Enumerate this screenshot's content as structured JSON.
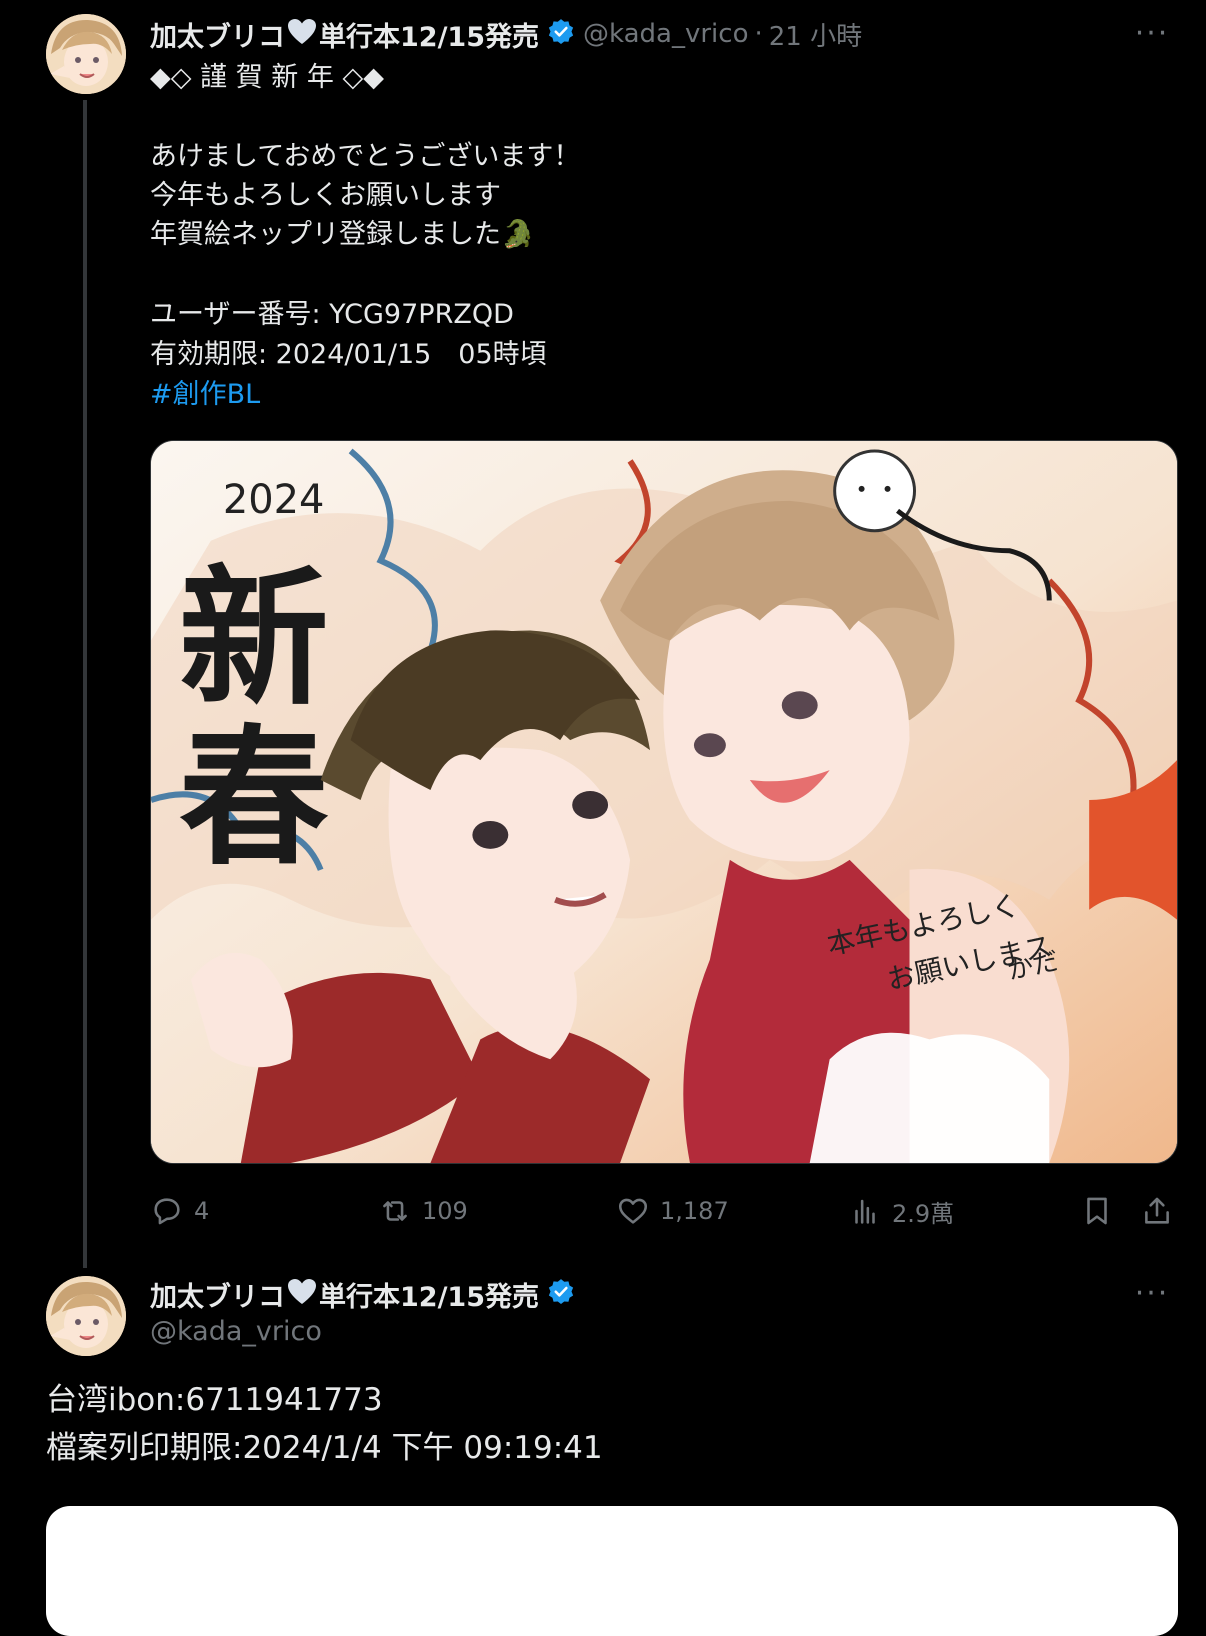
{
  "tweet1": {
    "display_name": "加太ブリコ",
    "name_suffix": "単行本12/15発売",
    "handle": "@kada_vrico",
    "separator": "·",
    "time": "21 小時",
    "more": "···",
    "lines": [
      "◆◇ 謹 賀 新 年 ◇◆",
      "",
      "あけましておめでとうございます！",
      "今年もよろしくお願いします",
      "年賀絵ネップリ登録しました🐊",
      "",
      "ユーザー番号: YCG97PRZQD",
      "有効期限: 2024/01/15　05時頃"
    ],
    "hashtag": "#創作BL",
    "image": {
      "year": "2024",
      "big_text_1": "新",
      "big_text_2": "春",
      "message_line_1": "本年もよろしく",
      "message_line_2": "お願いしまス",
      "signature": "かだ"
    },
    "actions": {
      "replies": "4",
      "retweets": "109",
      "likes": "1,187",
      "views": "2.9萬"
    }
  },
  "tweet2": {
    "display_name": "加太ブリコ",
    "name_suffix": "単行本12/15発売",
    "handle": "@kada_vrico",
    "more": "···",
    "line1": "台湾ibon:6711941773",
    "line2": "檔案列印期限:2024/1/4 下午 09:19:41"
  },
  "colors": {
    "background": "#000000",
    "text": "#e7e9ea",
    "muted": "#71767b",
    "link": "#1d9bf0",
    "verified": "#1d9bf0",
    "heart": "#d8e0ea"
  }
}
